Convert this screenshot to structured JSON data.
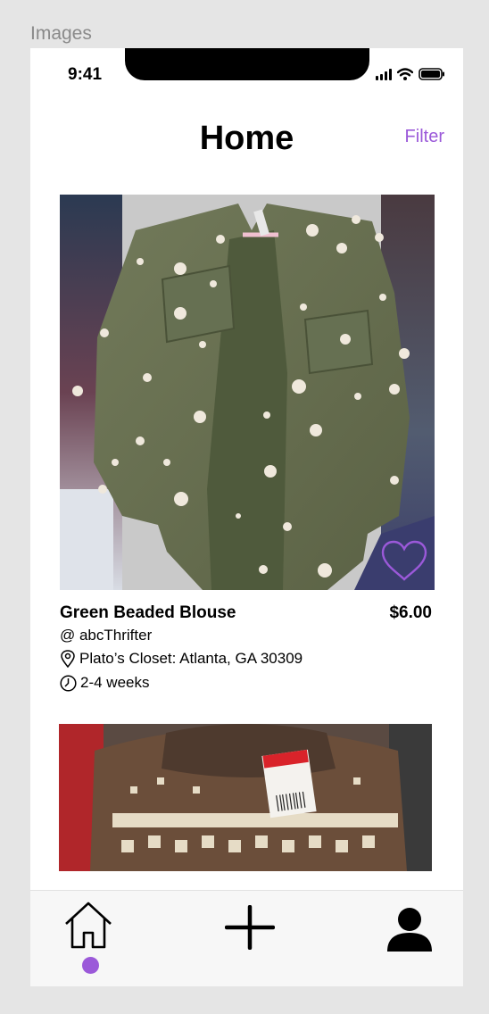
{
  "frame": {
    "label": "Images"
  },
  "status_bar": {
    "time": "9:41",
    "icons": [
      "signal-icon",
      "wifi-icon",
      "battery-icon"
    ]
  },
  "header": {
    "title": "Home",
    "filter_label": "Filter"
  },
  "listings": [
    {
      "title": "Green Beaded Blouse",
      "price": "$6.00",
      "user": "@ abcThrifter",
      "location": "Plato’s Closet: Atlanta, GA 30309",
      "duration": "2-4 weeks",
      "favorite_icon": "heart-outline-icon"
    }
  ],
  "tab_bar": {
    "items": [
      "home-icon",
      "plus-icon",
      "profile-icon"
    ],
    "active": "home"
  },
  "colors": {
    "accent": "#9b59d9",
    "text": "#000000",
    "tabbar_bg": "#f7f7f7"
  }
}
